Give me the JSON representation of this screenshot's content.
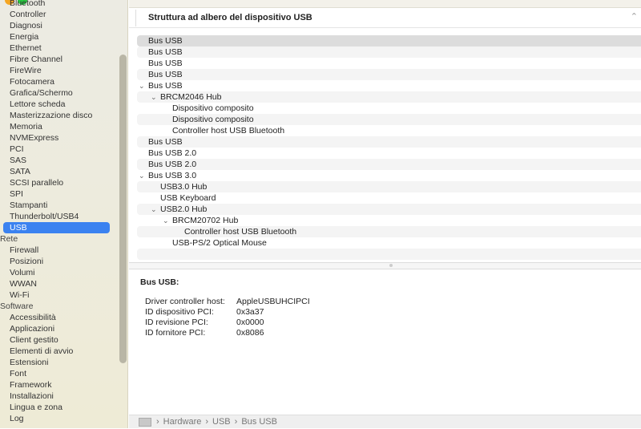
{
  "sidebar": {
    "items": [
      "Bluetooth",
      "Controller",
      "Diagnosi",
      "Energia",
      "Ethernet",
      "Fibre Channel",
      "FireWire",
      "Fotocamera",
      "Grafica/Schermo",
      "Lettore scheda",
      "Masterizzazione disco",
      "Memoria",
      "NVMExpress",
      "PCI",
      "SAS",
      "SATA",
      "SCSI parallelo",
      "SPI",
      "Stampanti",
      "Thunderbolt/USB4",
      "USB"
    ],
    "section_rete": "Rete",
    "rete_items": [
      "Firewall",
      "Posizioni",
      "Volumi",
      "WWAN",
      "Wi-Fi"
    ],
    "section_software": "Software",
    "software_items": [
      "Accessibilità",
      "Applicazioni",
      "Client gestito",
      "Elementi di avvio",
      "Estensioni",
      "Font",
      "Framework",
      "Installazioni",
      "Lingua e zona",
      "Log"
    ],
    "selected": "USB",
    "accent": "#3b82f0"
  },
  "header": {
    "title": "Struttura ad albero del dispositivo USB",
    "collapse_icon": "chevron-up-icon"
  },
  "tree": [
    {
      "label": "Bus USB",
      "level": 0,
      "expanded": false
    },
    {
      "label": "Bus USB",
      "level": 0,
      "expanded": false
    },
    {
      "label": "Bus USB",
      "level": 0,
      "expanded": false
    },
    {
      "label": "Bus USB",
      "level": 0,
      "expanded": false
    },
    {
      "label": "Bus USB",
      "level": 0,
      "expanded": true
    },
    {
      "label": "BRCM2046 Hub",
      "level": 1,
      "expanded": true
    },
    {
      "label": "Dispositivo composito",
      "level": 2,
      "expanded": false
    },
    {
      "label": "Dispositivo composito",
      "level": 2,
      "expanded": false
    },
    {
      "label": "Controller host USB Bluetooth",
      "level": 2,
      "expanded": false
    },
    {
      "label": "Bus USB",
      "level": 0,
      "expanded": false
    },
    {
      "label": "Bus USB 2.0",
      "level": 0,
      "expanded": false
    },
    {
      "label": "Bus USB 2.0",
      "level": 0,
      "expanded": false
    },
    {
      "label": "Bus USB 3.0",
      "level": 0,
      "expanded": true
    },
    {
      "label": "USB3.0 Hub",
      "level": 1,
      "expanded": false
    },
    {
      "label": "USB Keyboard",
      "level": 1,
      "expanded": false
    },
    {
      "label": "USB2.0 Hub",
      "level": 1,
      "expanded": true
    },
    {
      "label": "BRCM20702 Hub",
      "level": 2,
      "expanded": true
    },
    {
      "label": "Controller host USB Bluetooth",
      "level": 3,
      "expanded": false
    },
    {
      "label": "USB-PS/2 Optical Mouse",
      "level": 2,
      "expanded": false
    }
  ],
  "detail": {
    "title": "Bus USB:",
    "fields": [
      {
        "key": "Driver controller host:",
        "value": "AppleUSBUHCIPCI"
      },
      {
        "key": "ID dispositivo PCI:",
        "value": "0x3a37"
      },
      {
        "key": "ID revisione PCI:",
        "value": "0x0000"
      },
      {
        "key": "ID fornitore PCI:",
        "value": "0x8086"
      }
    ]
  },
  "breadcrumb": [
    "Hardware",
    "USB",
    "Bus USB"
  ],
  "breadcrumb_sep": "›"
}
